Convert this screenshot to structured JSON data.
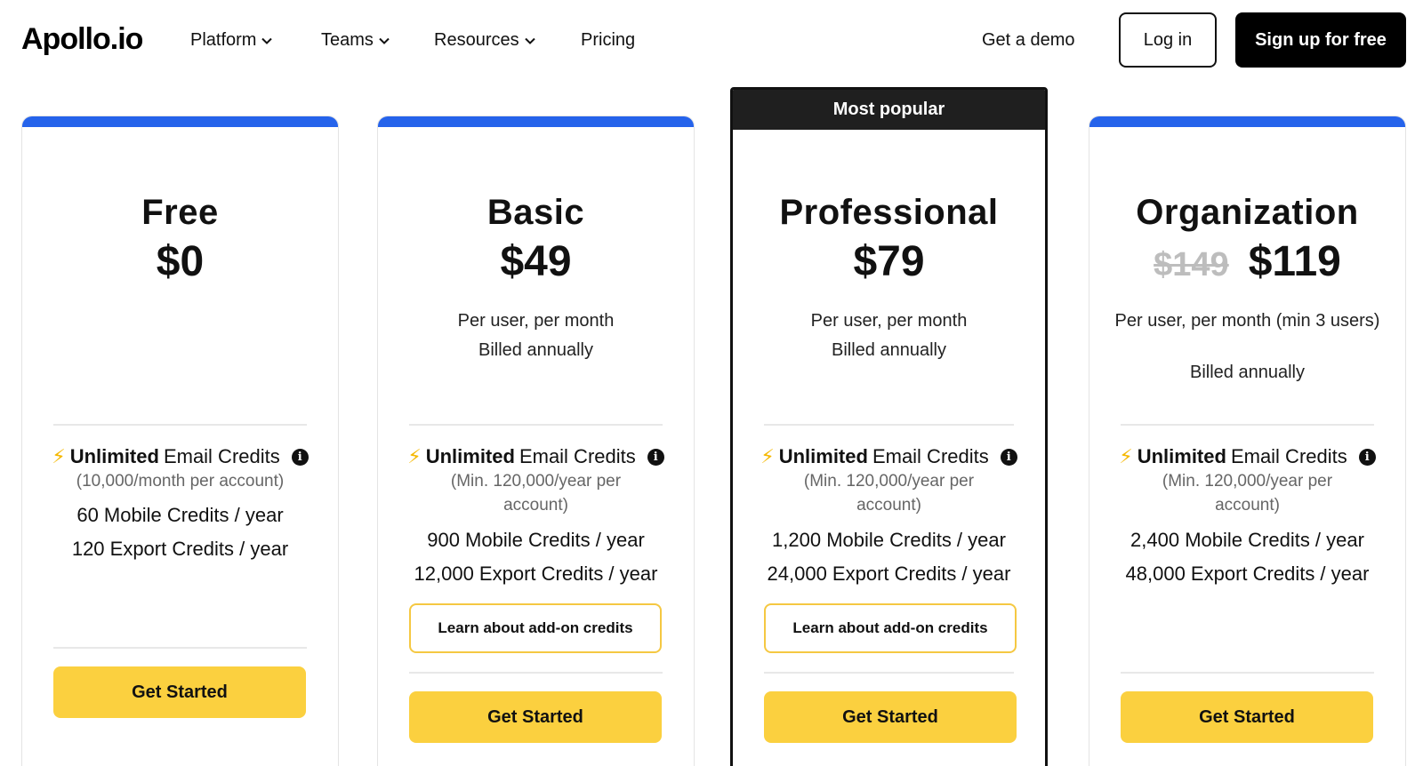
{
  "nav": {
    "logo": "Apollo.io",
    "items": [
      {
        "label": "Platform",
        "dropdown": true
      },
      {
        "label": "Teams",
        "dropdown": true
      },
      {
        "label": "Resources",
        "dropdown": true
      },
      {
        "label": "Pricing",
        "dropdown": false
      }
    ],
    "demo_label": "Get a demo",
    "login_label": "Log in",
    "signup_label": "Sign up for free"
  },
  "colors": {
    "accent_bar": "#2563eb",
    "cta": "#fbd03f",
    "addon_border": "#f5c842",
    "popular_banner": "#1f1f1f"
  },
  "plans": [
    {
      "name": "Free",
      "price": "$0",
      "email_bold": "Unlimited",
      "email_rest": "Email Credits",
      "email_note": "(10,000/month per account)",
      "mobile": "60 Mobile Credits / year",
      "export": "120 Export Credits / year",
      "cta": "Get Started"
    },
    {
      "name": "Basic",
      "price": "$49",
      "per": "Per user, per month",
      "billed": "Billed annually",
      "email_bold": "Unlimited",
      "email_rest": "Email Credits",
      "email_note": "(Min. 120,000/year per account)",
      "mobile": "900 Mobile Credits / year",
      "export": "12,000 Export Credits / year",
      "addon": "Learn about add-on credits",
      "cta": "Get Started"
    },
    {
      "badge": "Most popular",
      "name": "Professional",
      "price": "$79",
      "per": "Per user, per month",
      "billed": "Billed annually",
      "email_bold": "Unlimited",
      "email_rest": "Email Credits",
      "email_note": "(Min. 120,000/year per account)",
      "mobile": "1,200 Mobile Credits / year",
      "export": "24,000 Export Credits / year",
      "addon": "Learn about add-on credits",
      "cta": "Get Started"
    },
    {
      "name": "Organization",
      "old_price": "$149",
      "price": "$119",
      "per": "Per user, per month (min 3 users)",
      "billed": "Billed annually",
      "email_bold": "Unlimited",
      "email_rest": "Email Credits",
      "email_note": "(Min. 120,000/year per account)",
      "mobile": "2,400 Mobile Credits / year",
      "export": "48,000 Export Credits / year",
      "cta": "Get Started"
    }
  ]
}
